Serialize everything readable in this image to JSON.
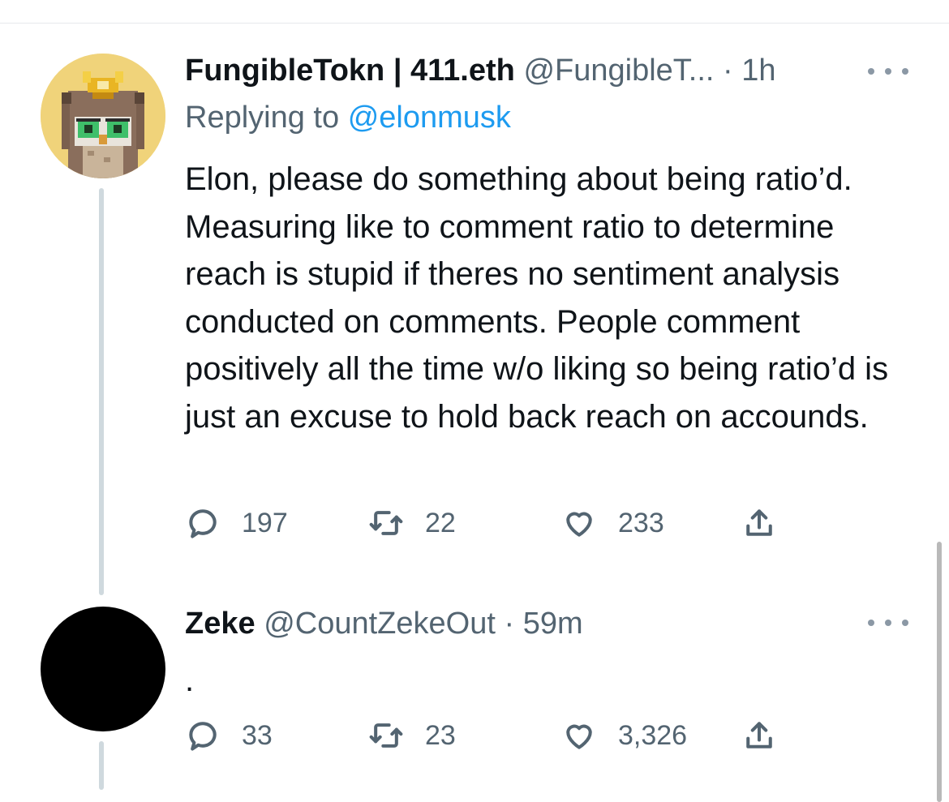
{
  "tweets": [
    {
      "author_name": "FungibleTokn | 411.eth",
      "handle": "@FungibleT...",
      "separator": "·",
      "time": "1h",
      "replying_prefix": "Replying to",
      "replying_to": "@elonmusk",
      "text": "Elon, please do something about being ratio’d. Measuring like to comment ratio to determine reach is stupid if theres no sentiment analysis conducted on comments. People comment positively all the time w/o liking so being ratio’d is just an excuse to hold back reach on accounds.",
      "replies": "197",
      "retweets": "22",
      "likes": "233"
    },
    {
      "author_name": "Zeke",
      "handle": "@CountZekeOut",
      "separator": "·",
      "time": "59m",
      "text": ".",
      "replies": "33",
      "retweets": "23",
      "likes": "3,326"
    }
  ],
  "icons": {
    "reply": "reply-icon",
    "retweet": "retweet-icon",
    "like": "heart-icon",
    "share": "share-icon",
    "more": "more-icon"
  },
  "colors": {
    "link": "#1d9bf0",
    "secondary_text": "#536471",
    "thread_line": "#cfd9de",
    "owl_avatar_bg": "#f0d37a",
    "zeke_avatar_bg": "#000000"
  }
}
